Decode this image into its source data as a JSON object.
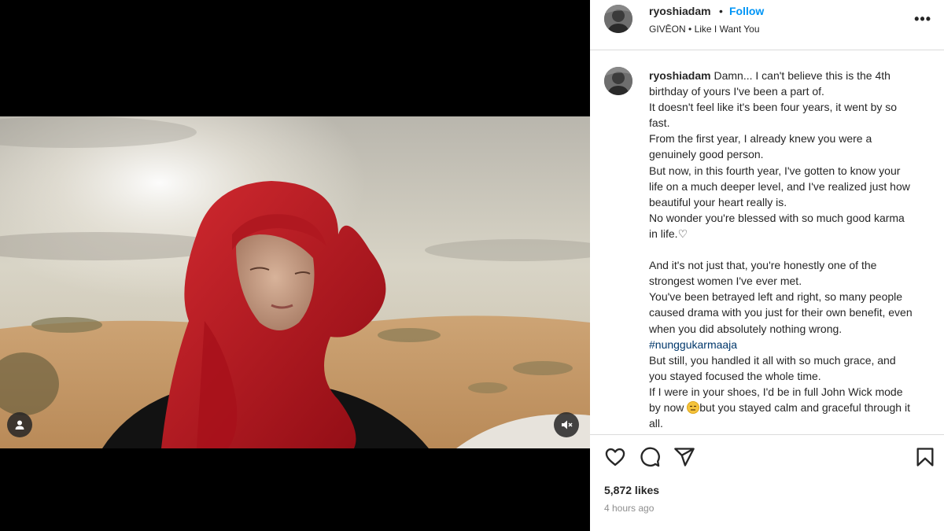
{
  "post": {
    "username": "ryoshiadam",
    "separator": "•",
    "follow_label": "Follow",
    "audio": "GIVĒON",
    "audio_sep": "•",
    "audio_track": "Like I Want You",
    "more_label": "•••"
  },
  "caption": {
    "username": "ryoshiadam",
    "line_01": " Damn... I can't believe this is the 4th birthday of yours I've been a part of.",
    "line_02": "It doesn't feel like it's been four years, it went by so fast.",
    "line_03": "From the first year, I already knew you were a genuinely good person.",
    "line_04": "But now, in this fourth year, I've gotten to know your life on a much deeper level, and I've realized just how beautiful your heart really is.",
    "line_05": "No wonder you're blessed with so much good karma in life.",
    "line_05_icon": "♡",
    "line_06": "And it's not just that, you're honestly one of the strongest women I've ever met.",
    "line_07a": "You've been betrayed left and right, so many people caused drama with you just for their own benefit, even when you did absolutely nothing wrong. ",
    "hashtag": "#nunggukarmaaja",
    "line_08": "But still, you handled it all with so much grace, and you stayed focused the whole time.",
    "line_09a": "If I were in your shoes, I'd be in full John Wick mode by now ",
    "line_09b": "but you stayed calm and graceful through it all."
  },
  "stats": {
    "likes": "5,872 likes",
    "time": "4 hours ago"
  },
  "icons": {
    "like": "heart-icon",
    "comment": "comment-icon",
    "share": "share-icon",
    "save": "bookmark-icon",
    "tag_people": "user-icon",
    "mute": "muted-speaker-icon",
    "emoji": "expressionless-face-emoji"
  },
  "colors": {
    "accent": "#0095f6",
    "hashtag": "#00376b",
    "scarf": "#c0151f"
  }
}
